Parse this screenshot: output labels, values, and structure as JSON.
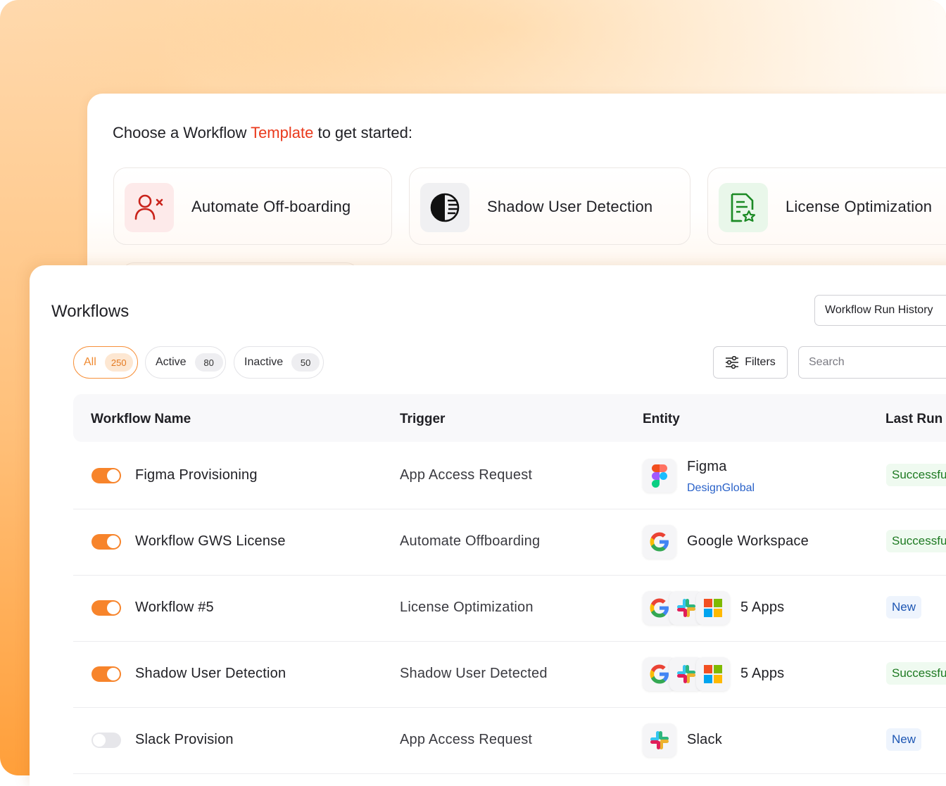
{
  "templates": {
    "heading_prefix": "Choose a Workflow ",
    "heading_accent": "Template",
    "heading_suffix": " to get started:",
    "cards": [
      {
        "label": "Automate Off-boarding",
        "icon": "user-remove-icon"
      },
      {
        "label": "Shadow User Detection",
        "icon": "shadow-circle-icon"
      },
      {
        "label": "License Optimization",
        "icon": "license-document-icon"
      }
    ]
  },
  "workflows": {
    "title": "Workflows",
    "run_history_label": "Workflow Run History",
    "filters_label": "Filters",
    "search_placeholder": "Search",
    "tabs": [
      {
        "label": "All",
        "count": "250"
      },
      {
        "label": "Active",
        "count": "80"
      },
      {
        "label": "Inactive",
        "count": "50"
      }
    ],
    "columns": [
      "Workflow Name",
      "Trigger",
      "Entity",
      "Last Run"
    ],
    "rows": [
      {
        "name": "Figma Provisioning",
        "trigger": "App Access Request",
        "entity": "Figma",
        "entity_sub": "DesignGlobal",
        "status": "Successful",
        "enabled": true,
        "icons": [
          "figma-logo-icon"
        ]
      },
      {
        "name": "Workflow GWS License",
        "trigger": "Automate Offboarding",
        "entity": "Google Workspace",
        "status": "Successful",
        "enabled": true,
        "icons": [
          "google-logo-icon"
        ]
      },
      {
        "name": "Workflow #5",
        "trigger": "License Optimization",
        "entity": "5 Apps",
        "status": "New",
        "enabled": true,
        "icons": [
          "google-logo-icon",
          "slack-logo-icon",
          "microsoft-logo-icon"
        ]
      },
      {
        "name": "Shadow User Detection",
        "trigger": "Shadow User Detected",
        "entity": "5 Apps",
        "status": "Successful",
        "enabled": true,
        "icons": [
          "google-logo-icon",
          "slack-logo-icon",
          "microsoft-logo-icon"
        ]
      },
      {
        "name": "Slack Provision",
        "trigger": "App Access Request",
        "entity": "Slack",
        "status": "New",
        "enabled": false,
        "icons": [
          "slack-logo-icon"
        ]
      }
    ]
  },
  "colors": {
    "accent_orange": "#f7842b",
    "template_accent_red": "#ea3a1c",
    "success_green": "#1e7a22",
    "new_blue": "#1d56b3",
    "link_blue": "#2a62c9"
  }
}
